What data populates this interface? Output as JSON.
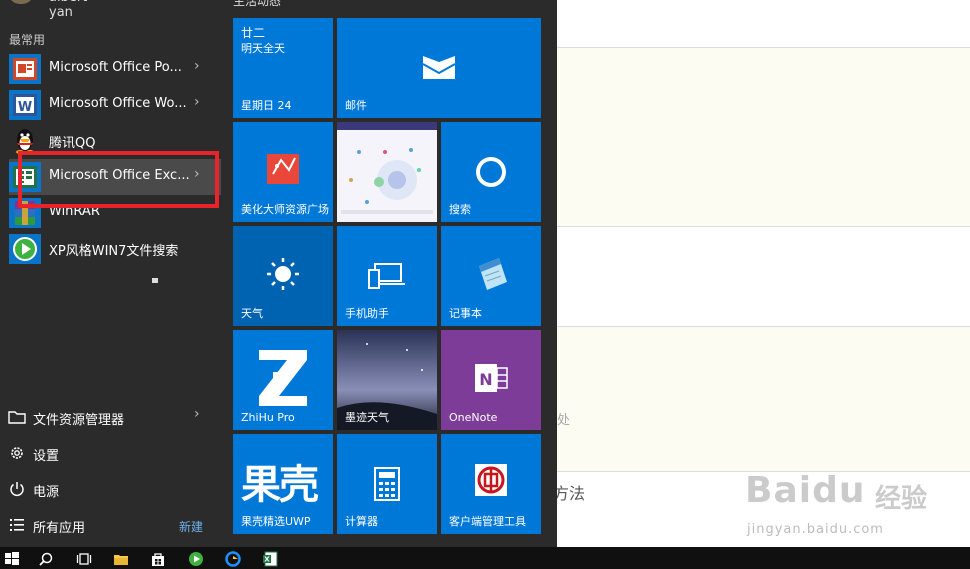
{
  "user": {
    "name": "albert yan"
  },
  "start_menu": {
    "most_used_label": "最常用",
    "apps": [
      {
        "label": "Microsoft Office Po...",
        "has_arrow": true
      },
      {
        "label": "Microsoft Office Wo...",
        "has_arrow": true
      },
      {
        "label": "腾讯QQ",
        "has_arrow": false
      },
      {
        "label": "Microsoft Office Exc...",
        "has_arrow": true
      },
      {
        "label": "WinRAR",
        "has_arrow": false
      },
      {
        "label": "XP风格WIN7文件搜索",
        "has_arrow": false
      }
    ],
    "system": {
      "file_explorer": "文件资源管理器",
      "settings": "设置",
      "power": "电源",
      "all_apps": "所有应用",
      "new_badge": "新建"
    },
    "tiles_header": "生活动态"
  },
  "tiles": {
    "calendar": {
      "top": "廿二",
      "sub": "明天全天",
      "label": "星期日 24"
    },
    "mail": {
      "label": "邮件"
    },
    "meihua": {
      "label": "美化大师资源广场"
    },
    "search": {
      "label": "搜索"
    },
    "weather": {
      "label": "天气"
    },
    "phone": {
      "label": "手机助手"
    },
    "notepad": {
      "label": "记事本"
    },
    "zhihu": {
      "label": "ZhiHu Pro"
    },
    "moji": {
      "label": "墨迹天气"
    },
    "onenote": {
      "label": "OneNote"
    },
    "guoke": {
      "big": "果壳",
      "label": "果壳精选UWP"
    },
    "calculator": {
      "label": "计算器"
    },
    "icbc": {
      "label": "客户端管理工具"
    }
  },
  "background": {
    "text_1": "处",
    "text_2": "方法",
    "watermark_main": "Baidu",
    "watermark_cn": "经验",
    "watermark_sub": "jingyan.baidu.com"
  },
  "colors": {
    "tile_blue": "#0078d7",
    "tile_purple": "#7d3c98",
    "highlight_red": "#e8232a",
    "menu_bg": "#2b2b2b"
  }
}
